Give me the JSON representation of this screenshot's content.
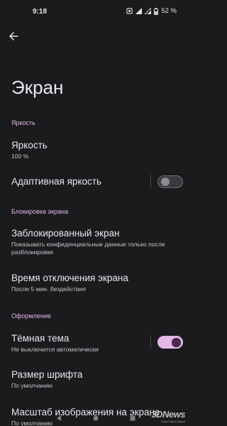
{
  "status_bar": {
    "time": "9:18",
    "battery": "52 %"
  },
  "page": {
    "title": "Экран"
  },
  "sections": {
    "brightness_header": "Яркость",
    "lock_header": "Блокировка экрана",
    "design_header": "Оформление"
  },
  "items": {
    "brightness": {
      "title": "Яркость",
      "summary": "100 %"
    },
    "adaptive": {
      "title": "Адаптивная яркость",
      "enabled": false
    },
    "lockscreen": {
      "title": "Заблокированный экран",
      "summary": "Показывать конфиденциальные данные только после разблокировки"
    },
    "timeout": {
      "title": "Время отключения экрана",
      "summary": "После 5 мин. бездействия"
    },
    "dark_theme": {
      "title": "Тёмная тема",
      "summary": "Не выключится автоматически",
      "enabled": true
    },
    "font_size": {
      "title": "Размер шрифта",
      "summary": "По умолчанию"
    },
    "display_size": {
      "title": "Масштаб изображения на экране",
      "summary": "По умолчанию"
    }
  },
  "watermark": {
    "brand": "3DNews",
    "sub": "Daily Digital Digest"
  },
  "colors": {
    "background": "#1b1b1d",
    "accent": "#e7b6e9",
    "toggle_on": "#e4b7e8"
  }
}
